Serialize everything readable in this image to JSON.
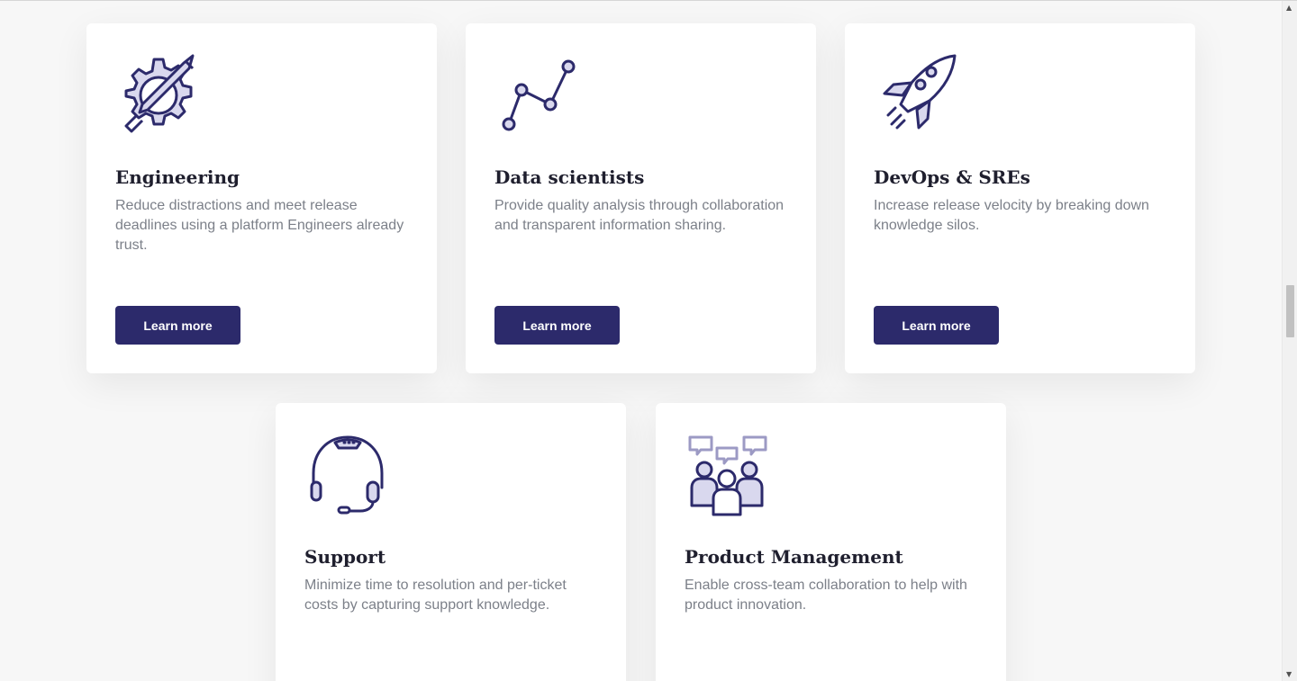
{
  "colors": {
    "accent": "#2c2a6b",
    "icon_fill": "#d9d8ee",
    "heading": "#1f1f2e",
    "body_text": "#7c8089",
    "page_bg": "#f7f7f7"
  },
  "cards": [
    {
      "icon": "gear-pencil-icon",
      "title": "Engineering",
      "description": "Reduce distractions and meet release deadlines using a platform Engineers already trust.",
      "button_label": "Learn more"
    },
    {
      "icon": "line-graph-icon",
      "title": "Data scientists",
      "description": "Provide quality analysis through collaboration and transparent information sharing.",
      "button_label": "Learn more"
    },
    {
      "icon": "rocket-icon",
      "title": "DevOps & SREs",
      "description": "Increase release velocity by breaking down knowledge silos.",
      "button_label": "Learn more"
    },
    {
      "icon": "headset-icon",
      "title": "Support",
      "description": "Minimize time to resolution and per-ticket costs by capturing support knowledge."
    },
    {
      "icon": "team-chat-icon",
      "title": "Product Management",
      "description": "Enable cross-team collaboration to help with product innovation."
    }
  ],
  "scrollbar": {
    "up_arrow": "▲",
    "down_arrow": "▼"
  }
}
